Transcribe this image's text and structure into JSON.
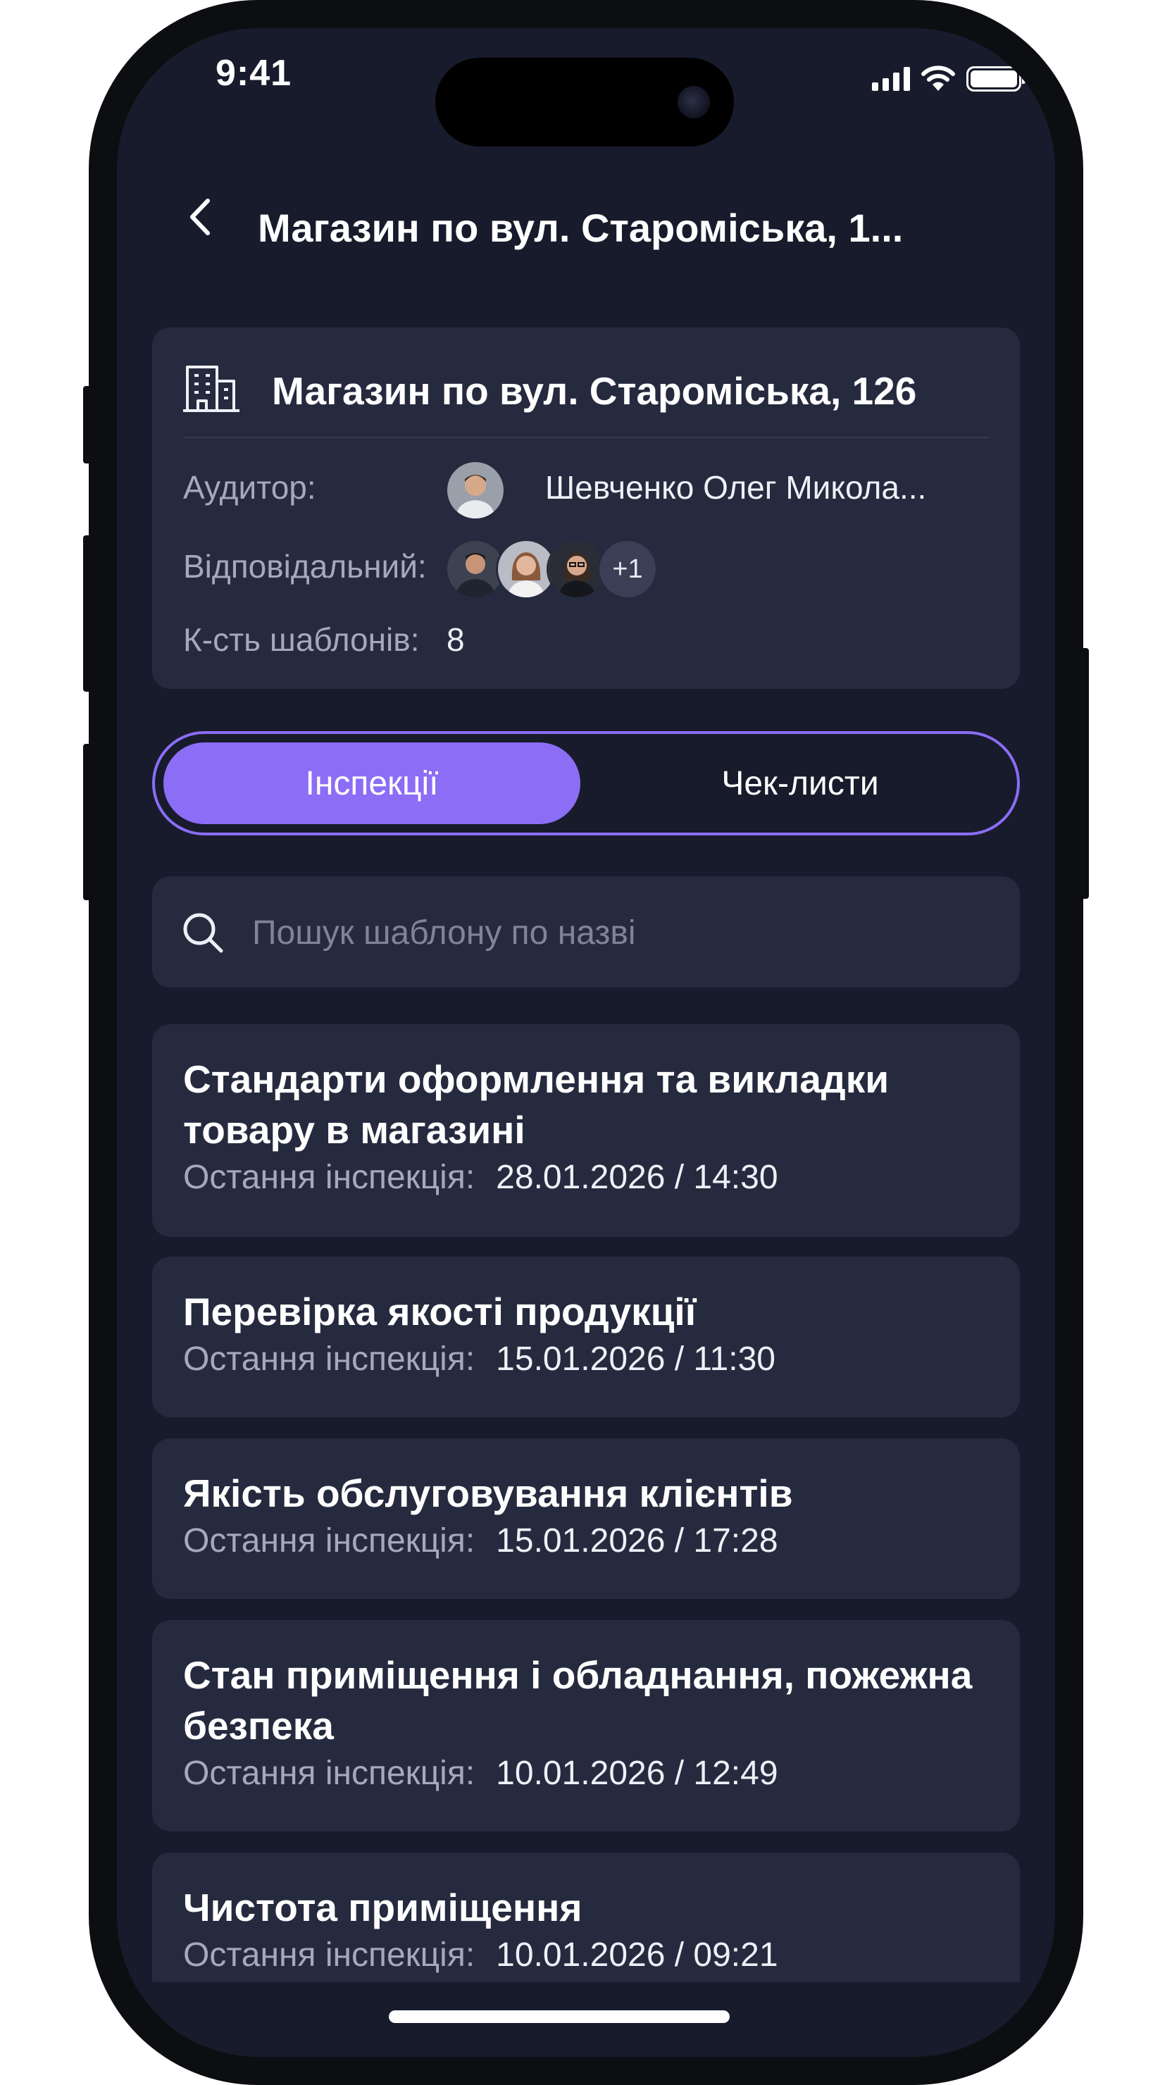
{
  "status_bar": {
    "time": "9:41"
  },
  "header": {
    "title": "Магазин по вул. Староміська, 1..."
  },
  "store": {
    "name": "Магазин по вул. Староміська, 126",
    "auditor_label": "Аудитор:",
    "auditor_name": "Шевченко Олег Микола...",
    "responsible_label": "Відповідальний:",
    "responsible_more": "+1",
    "templates_label": "К-сть шаблонів:",
    "templates_count": "8"
  },
  "tabs": {
    "active": "Інспекції",
    "other": "Чек-листи"
  },
  "search": {
    "placeholder": "Пошук шаблону по назві",
    "value": ""
  },
  "templates": [
    {
      "title": "Стандарти оформлення та викладки товару в магазині",
      "meta_label": "Остання інспекція:",
      "date": "28.01.2026 / 14:30"
    },
    {
      "title": "Перевірка якості продукції",
      "meta_label": "Остання інспекція:",
      "date": "15.01.2026 / 11:30"
    },
    {
      "title": "Якість обслуговування клієнтів",
      "meta_label": "Остання інспекція:",
      "date": "15.01.2026 / 17:28"
    },
    {
      "title": "Стан приміщення і обладнання, пожежна безпека",
      "meta_label": "Остання інспекція:",
      "date": "10.01.2026 / 12:49"
    },
    {
      "title": "Чистота приміщення",
      "meta_label": "Остання інспекція:",
      "date": "10.01.2026 / 09:21"
    }
  ],
  "colors": {
    "accent": "#8b6df6",
    "background": "#181b2b",
    "card": "#262a3e"
  }
}
